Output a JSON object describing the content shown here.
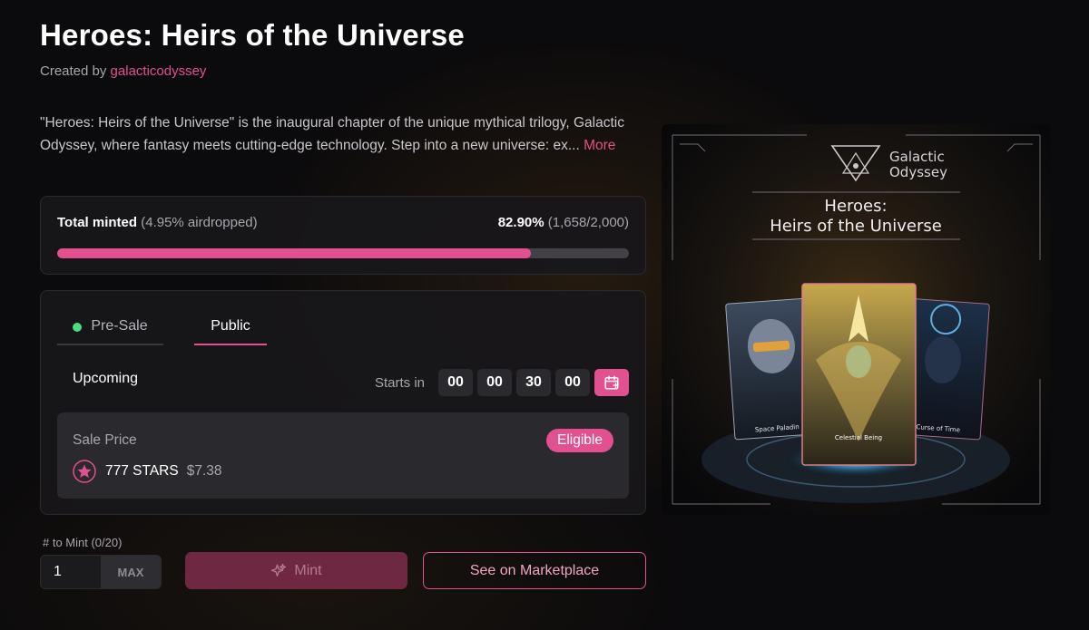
{
  "collection": {
    "title": "Heroes: Heirs of the Universe",
    "created_by_label": "Created by",
    "creator": "galacticodyssey",
    "description": "\"Heroes: Heirs of the Universe\" is the inaugural chapter of the unique mythical trilogy, Galactic Odyssey, where fantasy meets cutting-edge technology. Step into a new universe: ex...",
    "more_label": "More"
  },
  "minted": {
    "label": "Total minted",
    "airdrop_note": "(4.95% airdropped)",
    "percent_text": "82.90%",
    "count_text": "(1,658/2,000)",
    "progress": 0.829
  },
  "sale": {
    "tabs": [
      {
        "label": "Pre-Sale",
        "active": false
      },
      {
        "label": "Public",
        "active": true
      }
    ],
    "status": "Upcoming",
    "starts_in_label": "Starts in",
    "countdown": [
      "00",
      "00",
      "30",
      "00"
    ],
    "price_label": "Sale Price",
    "eligible_label": "Eligible",
    "price_amount": "777 STARS",
    "price_usd": "$7.38"
  },
  "mint": {
    "qty_label": "# to Mint (0/20)",
    "qty_value": "1",
    "max_label": "MAX",
    "mint_button": "Mint",
    "marketplace_button": "See on Marketplace"
  },
  "artwork": {
    "brand_line1": "Galactic",
    "brand_line2": "Odyssey",
    "title_line1": "Heroes:",
    "title_line2": "Heirs of the Universe",
    "cards": [
      "Space Paladin",
      "Celestial Being",
      "Curse of Time"
    ]
  },
  "colors": {
    "accent": "#e2508f",
    "live_dot": "#4ade80"
  }
}
